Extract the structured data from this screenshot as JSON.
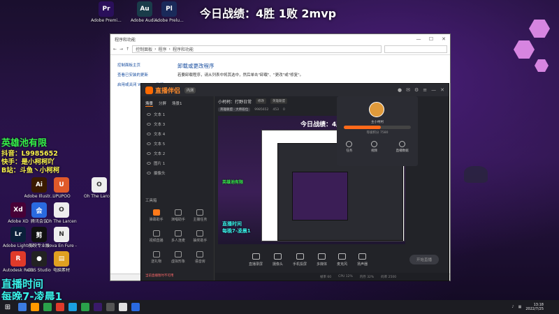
{
  "stream_title": "今日战绩：4胜 1败 2mvp",
  "overlay": {
    "team": "英雄池有限",
    "douyin": "抖音：L9985652",
    "kuaishou": "快手：是小柯柯吖",
    "bilibili": "B站：斗鱼丶小柯柯",
    "live_time_label": "直播时间",
    "live_time_value": "每晚7-凌晨1"
  },
  "desktop_icons": [
    {
      "label": "Adobe Premi...",
      "color": "#2a0f5a",
      "glyph": "Pr"
    },
    {
      "label": "Adobe Audi...",
      "color": "#1a3c4a",
      "glyph": "Au"
    },
    {
      "label": "Adobe Prelu...",
      "color": "#1a2a5a",
      "glyph": "Pl"
    },
    {
      "label": "Adobe Illustr...",
      "color": "#3a1a00",
      "glyph": "Ai"
    },
    {
      "label": "UPUPOO",
      "color": "#e05a2a",
      "glyph": "U"
    },
    {
      "label": "Oh The Larceny...",
      "color": "#eeeeee",
      "glyph": "O"
    },
    {
      "label": "Adobe XD",
      "color": "#470137",
      "glyph": "Xd"
    },
    {
      "label": "腾讯会议",
      "color": "#2a6ae0",
      "glyph": "会"
    },
    {
      "label": "Oh The Larceny...",
      "color": "#eeeeee",
      "glyph": "O"
    },
    {
      "label": "Adobe Lightroo...",
      "color": "#0a1f3a",
      "glyph": "Lr"
    },
    {
      "label": "剪映专业版",
      "color": "#111111",
      "glyph": "剪"
    },
    {
      "label": "Nova En Fure - La...",
      "color": "#eeeeee",
      "glyph": "N"
    },
    {
      "label": "Autodesk ReCap",
      "color": "#e03a2a",
      "glyph": "R"
    },
    {
      "label": "OBS Studio",
      "color": "#222222",
      "glyph": "●"
    },
    {
      "label": "电脑素材",
      "color": "#e0a020",
      "glyph": "▤"
    }
  ],
  "explorer": {
    "title": "程序和功能",
    "path": [
      "控制面板",
      "程序",
      "程序和功能"
    ],
    "sidebar": [
      "控制面板主页",
      "查看已安装的更新",
      "启用或关闭 Windows 功能"
    ],
    "main_title": "卸载或更改程序",
    "main_desc": "若要卸载程序，请从列表中将其选中，然后单击\"卸载\"、\"更改\"或\"修复\"。"
  },
  "live_app": {
    "app_name": "直播伴侣",
    "tag": "内测",
    "tabs": [
      "场景",
      "分屏",
      "场景1"
    ],
    "scenes": [
      "文本 1",
      "文本 3",
      "文本 4",
      "文本 5",
      "文本 2",
      "图片 1",
      "摄像头"
    ],
    "room_title": "小柯柯：打野日常",
    "room_edit": "修改",
    "room_category": "英雄联盟",
    "room_info": [
      "英雄联盟 · 大师段位",
      "9985652",
      "453",
      "0"
    ],
    "tools_title": "工具箱",
    "tools": [
      "弹幕助手",
      "演唱助手",
      "主播任务",
      "视频直播",
      "多人连麦",
      "抽奖助手",
      "送礼物",
      "虚拟形象",
      "语音房"
    ],
    "footer_note": "当前直播暂时不可用",
    "user": {
      "id": "主小柯柯",
      "level": "等级积分 7580",
      "progress": 0.55
    },
    "user_actions": [
      "任务",
      "视频",
      "直播数据"
    ],
    "bottom_buttons": [
      "直播录屏",
      "摄像头",
      "手机投屏",
      "多媒体",
      "麦克风",
      "扬声器"
    ],
    "start_button": "开始直播",
    "status": [
      "帧率 60",
      "CPU 12%",
      "内存 32%",
      "码率 2500"
    ]
  },
  "taskbar": {
    "time": "13:18",
    "date": "2022/7/25",
    "icons": [
      "#3b7be0",
      "#ff9a00",
      "#2aa24a",
      "#e03a2a",
      "#1aa0e0",
      "#2aa24a",
      "#3a1a6a",
      "#555555",
      "#e0e0e0",
      "#2a6ae0"
    ]
  }
}
